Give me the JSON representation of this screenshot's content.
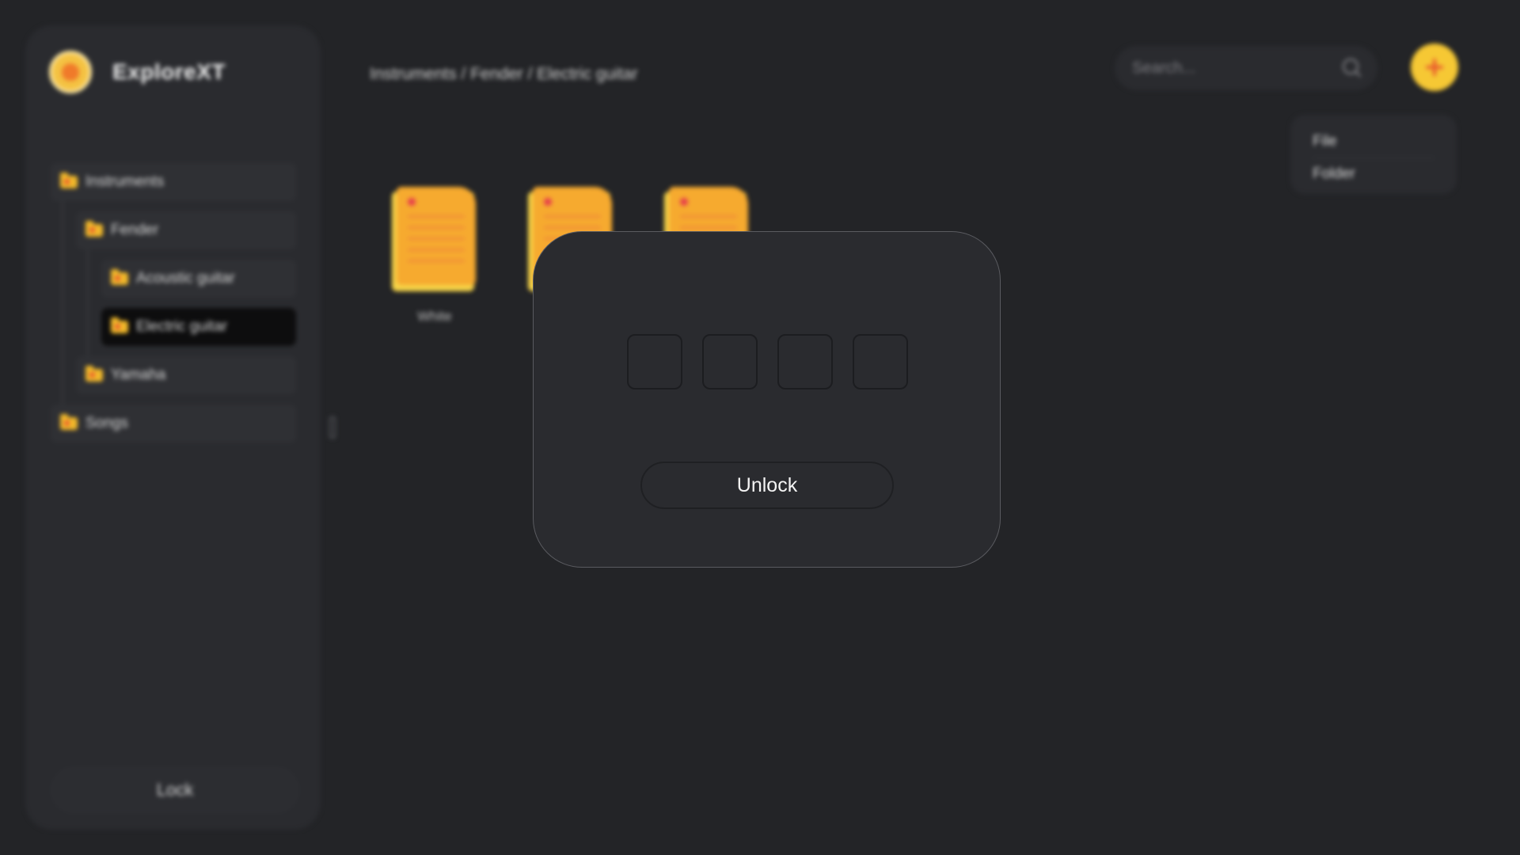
{
  "app": {
    "name": "ExploreXT"
  },
  "breadcrumb": "Instruments / Fender / Electric guitar",
  "search": {
    "placeholder": "Search..."
  },
  "new_menu": {
    "items": [
      "File",
      "Folder"
    ]
  },
  "sidebar": {
    "items": [
      {
        "label": "Instruments",
        "active": false
      },
      {
        "label": "Fender",
        "active": false
      },
      {
        "label": "Acoustic guitar",
        "active": false
      },
      {
        "label": "Electric guitar",
        "active": true
      },
      {
        "label": "Yamaha",
        "active": false
      },
      {
        "label": "Songs",
        "active": false
      }
    ],
    "lock_label": "Lock"
  },
  "files": [
    {
      "name": "White"
    },
    {
      "name": ""
    },
    {
      "name": ""
    }
  ],
  "modal": {
    "pin_values": [
      "",
      "",
      "",
      ""
    ],
    "unlock_label": "Unlock"
  },
  "colors": {
    "background": "#232427",
    "panel": "#2a2b2f",
    "accent": "#f6c834",
    "accent_secondary": "#e8552d"
  }
}
